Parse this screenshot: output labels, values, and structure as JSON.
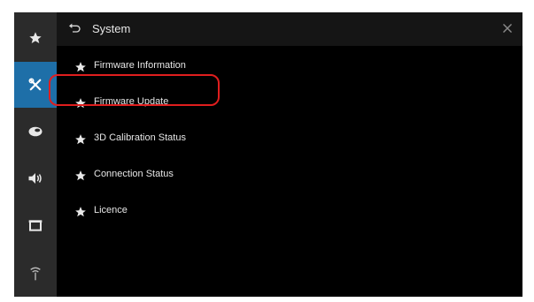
{
  "colors": {
    "rail_active": "#1e6fa8",
    "rail_bg": "#2b2b2b",
    "highlight": "#e01e1e"
  },
  "rail": {
    "items": [
      {
        "icon": "star-icon"
      },
      {
        "icon": "tools-icon"
      },
      {
        "icon": "disc-icon"
      },
      {
        "icon": "speaker-icon"
      },
      {
        "icon": "screen-icon"
      },
      {
        "icon": "antenna-icon"
      }
    ]
  },
  "header": {
    "title": "System",
    "back_icon": "back-arrow-icon",
    "close_icon": "close-icon"
  },
  "menu": {
    "items": [
      {
        "label": "Firmware Information"
      },
      {
        "label": "Firmware Update"
      },
      {
        "label": "3D Calibration Status"
      },
      {
        "label": "Connection Status"
      },
      {
        "label": "Licence"
      }
    ]
  }
}
